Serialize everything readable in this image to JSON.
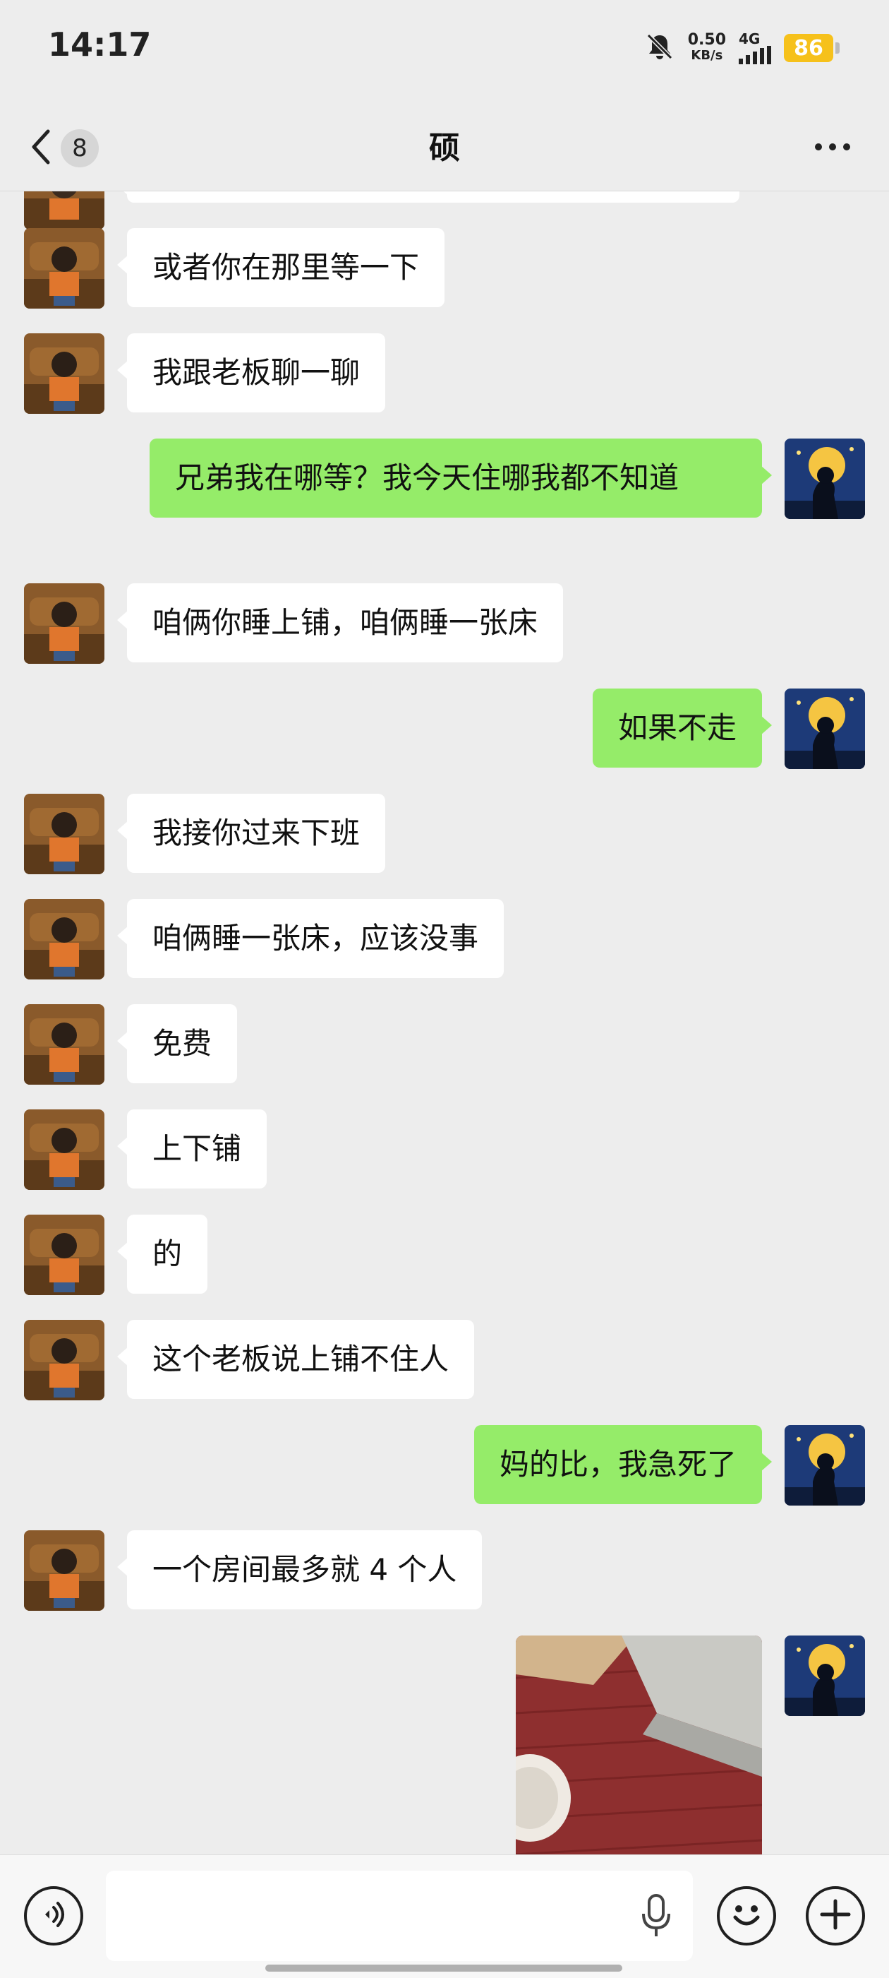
{
  "status_bar": {
    "time": "14:17",
    "speed_value": "0.50",
    "speed_unit": "KB/s",
    "network": "4G",
    "battery": "86",
    "icons": [
      "bell-off-icon",
      "signal-icon",
      "battery-icon"
    ]
  },
  "nav": {
    "unread_count": "8",
    "title": "硕",
    "back_icon": "chevron-left-icon",
    "more_icon": "more-icon"
  },
  "messages": [
    {
      "side": "in",
      "text": "或者你在那里等一下"
    },
    {
      "side": "in",
      "text": "我跟老板聊一聊"
    },
    {
      "side": "out",
      "text": "兄弟我在哪等？我今天住哪我都不知道"
    },
    {
      "side": "in",
      "text": "咱俩你睡上铺，咱俩睡一张床"
    },
    {
      "side": "out",
      "text": "如果不走"
    },
    {
      "side": "in",
      "text": "我接你过来下班"
    },
    {
      "side": "in",
      "text": "咱俩睡一张床，应该没事"
    },
    {
      "side": "in",
      "text": "免费"
    },
    {
      "side": "in",
      "text": "上下铺"
    },
    {
      "side": "in",
      "text": "的"
    },
    {
      "side": "in",
      "text": "这个老板说上铺不住人"
    },
    {
      "side": "out",
      "text": "妈的比，我急死了"
    },
    {
      "side": "in",
      "text": "一个房间最多就 4 个人"
    },
    {
      "side": "out",
      "type": "image"
    }
  ],
  "input_bar": {
    "voice_icon": "voice-icon",
    "mic_icon": "mic-icon",
    "emoji_icon": "emoji-icon",
    "plus_icon": "plus-icon",
    "placeholder": ""
  },
  "colors": {
    "background": "#ededed",
    "incoming_bubble": "#ffffff",
    "outgoing_bubble": "#95ec69",
    "battery": "#f6c11b"
  }
}
